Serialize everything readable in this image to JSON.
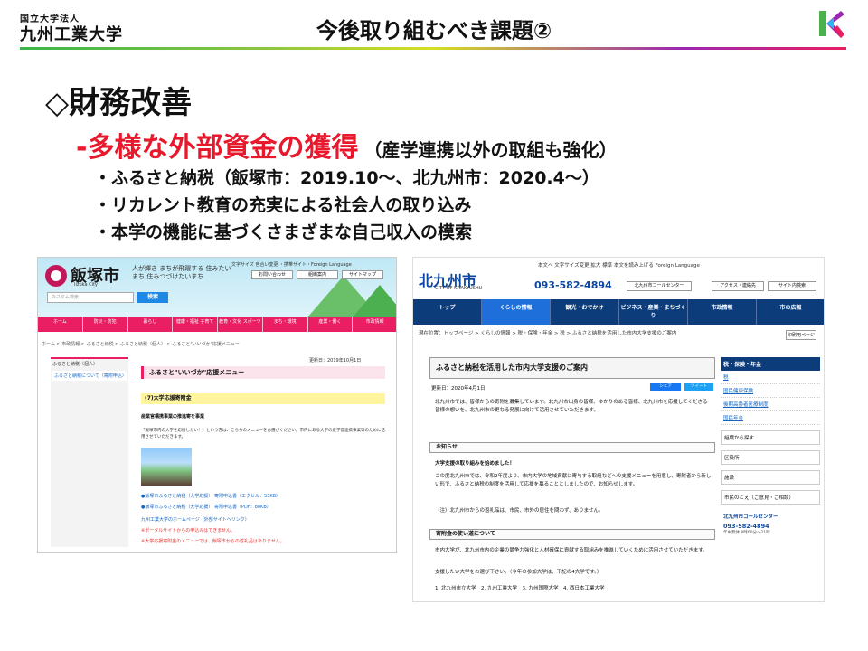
{
  "header": {
    "university_sub": "国立大学法人",
    "university_name": "九州工業大学",
    "slide_title": "今後取り組むべき課題②"
  },
  "content": {
    "heading": "◇財務改善",
    "subheading_red": "-多様な外部資金の獲得",
    "subheading_note": "（産学連携以外の取組も強化）",
    "bullets": [
      "・ふるさと納税（飯塚市：2019.10～、北九州市：2020.4～）",
      "・リカレント教育の充実による社会人の取り込み",
      "・本学の機能に基づくさまざまな自己収入の模索"
    ]
  },
  "iizuka": {
    "city_name": "飯塚市",
    "city_en": "Iizuka City",
    "slogan": "人が輝き まちが飛躍する 住みたいまち 住みつづけたいまち",
    "top_links": "文字サイズ 色合い変更 ・携帯サイト・Foreign Language",
    "buttons": [
      "お問い合わせ",
      "組織案内",
      "サイトマップ"
    ],
    "search_placeholder": "カスタム検索",
    "search_button": "検索",
    "nav": [
      "ホーム",
      "防災・防犯",
      "暮らし",
      "健康・福祉 子育て",
      "教育・文化 スポーツ",
      "まち・環境",
      "産業・働く",
      "市政情報"
    ],
    "breadcrumb": "ホーム > 市政情報 > ふるさと納税 > ふるさと納税（個人） > ふるさと\"いいづか\"応援メニュー",
    "side_title": "ふるさと納税（個人）",
    "side_link": "ふるさと納税について（寄附申込）",
    "updated": "更新日：2019年10月1日",
    "page_title": "ふるさと\"いいづか\"応援メニュー",
    "section": "(7)大学応援寄附金",
    "subhead": "産業官構携事業の推進寄を事業",
    "paragraph": "「飯塚市内の大学を応援したい！」という方は、こちらのメニューをお選びください。市内にある大学の産学官連携事業等のために活用させていただきます。",
    "links": [
      "●飯塚市ふるさと納税（大学応援） 寄附申込書（エクセル：53KB）",
      "●飯塚市ふるさと納税（大学応援） 寄附申込書（PDF：80KB）",
      "九州工業大学のホームページ（外部サイトへリンク）"
    ],
    "notes": [
      "※ポータルサイトからの申込みはできません。",
      "※大学応援寄附金のメニューでは、飯塚市からの返礼品はありません。"
    ]
  },
  "kitakyushu": {
    "top_links": "本文へ   文字サイズ変更 拡大 標準   本文を読み上げる   Foreign Language",
    "logo": "北九州市",
    "logo_en": "CITY OF KITAKYUSHU",
    "phone": "093-582-4894",
    "buttons": [
      "北九州市コールセンター",
      "アクセス・連絡先",
      "サイト内検索"
    ],
    "nav": [
      "トップ",
      "くらしの情報",
      "観光・おでかけ",
      "ビジネス・産業・まちづくり",
      "市政情報",
      "市の広報"
    ],
    "breadcrumb": "現在位置：トップページ > くらしの情報 > 税・保険・年金 > 税 > ふるさと納税を活用した市内大学支援のご案内",
    "print": "印刷用ページ",
    "page_title": "ふるさと納税を活用した市内大学支援のご案内",
    "date": "更新日：2020年4月1日",
    "share_fb": "シェア",
    "share_tw": "ツイート",
    "intro": "北九州市では、皆様からの寄附を募集しています。北九州市出身の皆様、ゆかりのある皆様、北九州市を応援してくださる皆様の想いを、北九州市の更なる発展に向けて活用させていただきます。",
    "notice_box": "お知らせ",
    "notice_title": "大学支援の取り組みを始めました！",
    "notice_text": "この度北九州市では、令和2年度より、市内大学の地域貢献に寄与する取組などへの支援メニューを用意し、寄附者から新しい形で、ふるさと納税の制度を活用して応援を募ることとしましたので、お知らせします。",
    "notice_note": "（注）北九州市からの返礼品は、市民、市外の居住を問わず、ありません。",
    "usage_box": "寄附金の使い道について",
    "usage_text": "市内大学が、北九州市内の企業の競争力強化と人材確保に貢献する取組みを推進していくために活用させていただきます。",
    "choose_text": "支援したい大学をお選び下さい。（今年の参加大学は、下記の4大学です。）",
    "universities": "1. 北九州市立大学　2. 九州工業大学　3. 九州国際大学　4. 西日本工業大学",
    "side_title": "税・保険・年金",
    "side_items": [
      "税",
      "国民健康保険",
      "後期高齢者医療制度",
      "国民年金"
    ],
    "side_boxes": [
      "組織から探す",
      "区役所",
      "施設",
      "市民のこえ（ご意見・ご相談）"
    ],
    "callcenter": "北九州市コールセンター",
    "callcenter_phone": "093-582-4894",
    "callcenter_hours": "年中無休 8時00分～21時"
  }
}
